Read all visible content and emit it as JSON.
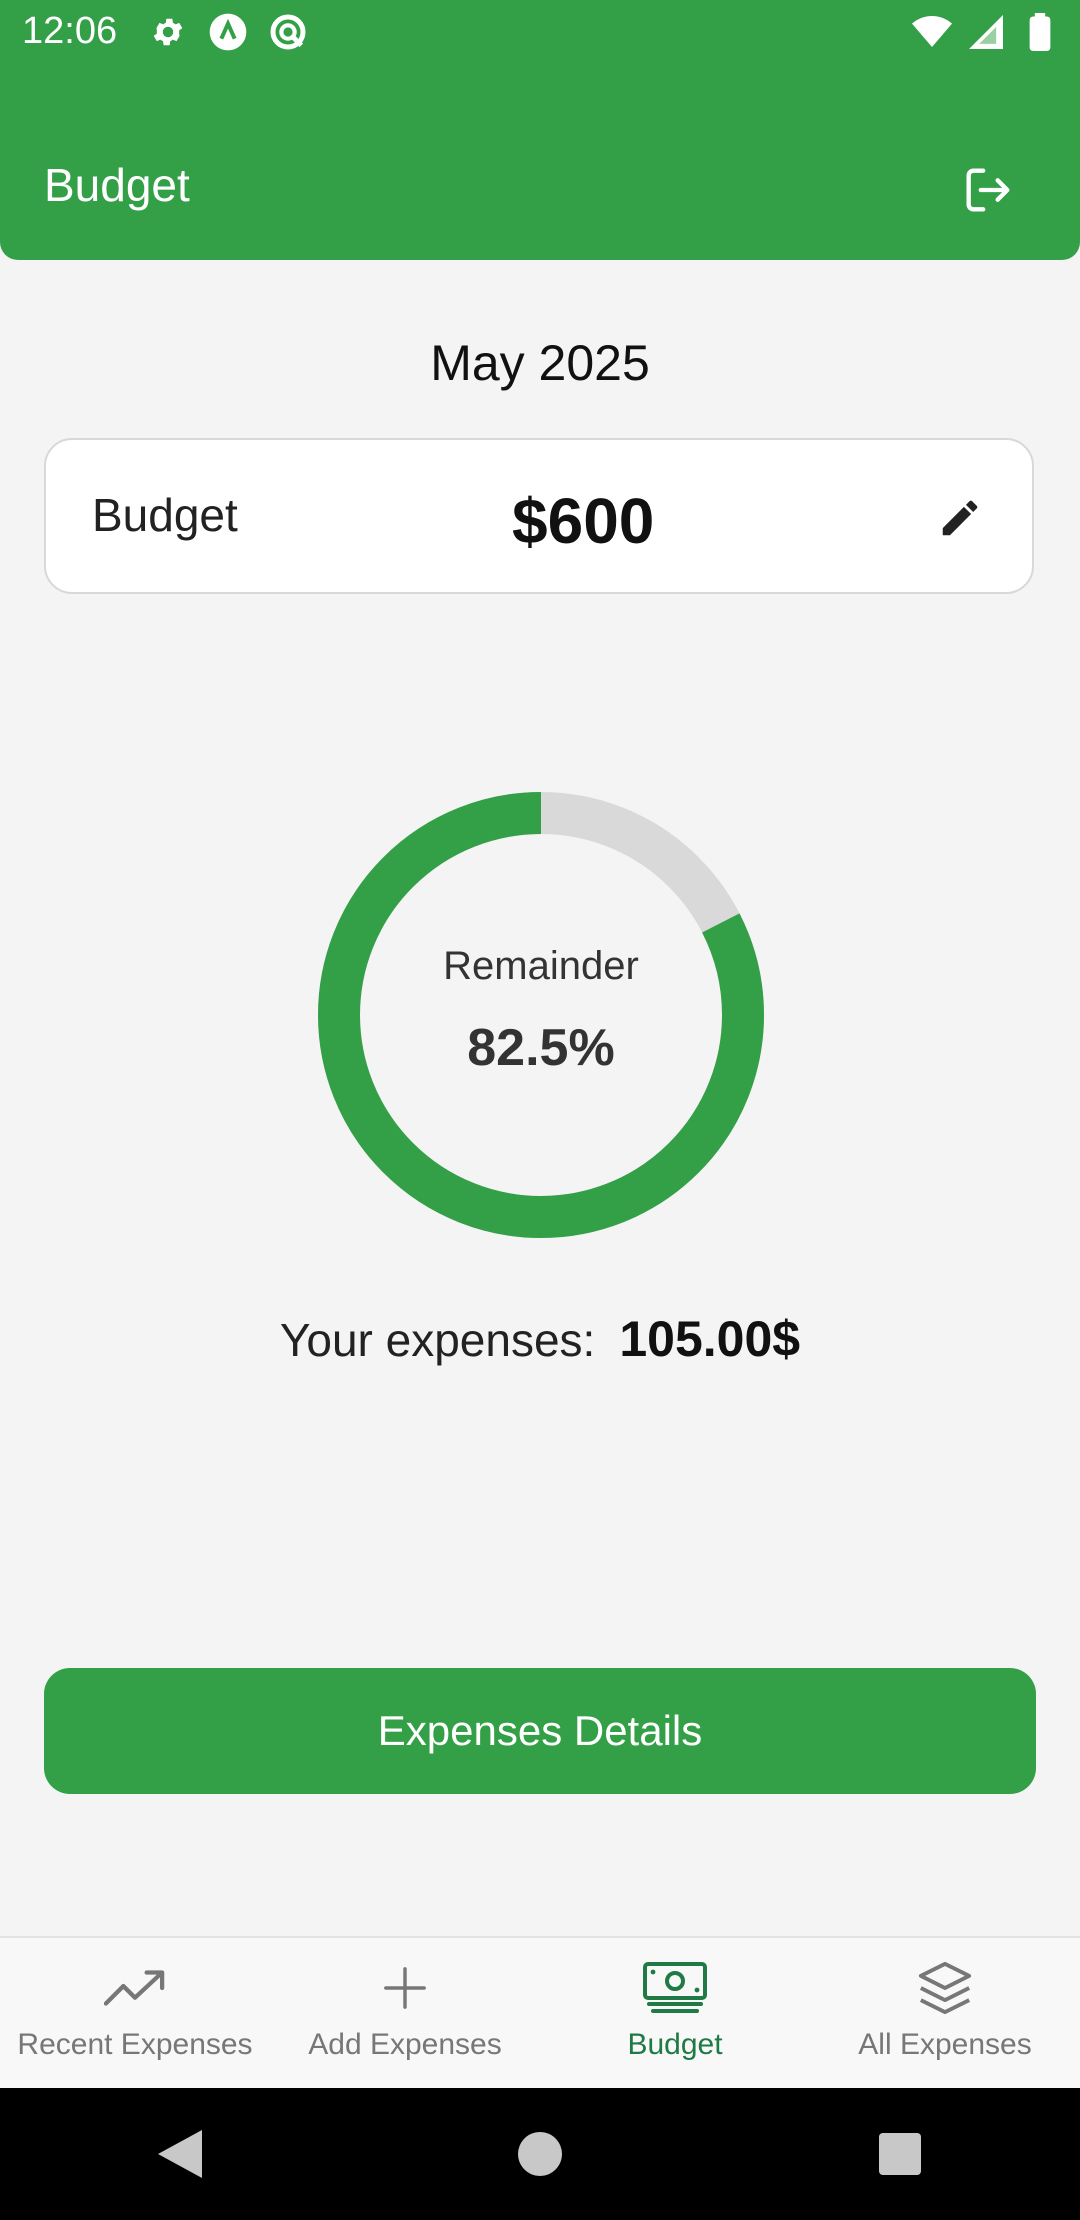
{
  "status_bar": {
    "time": "12:06"
  },
  "app_bar": {
    "title": "Budget"
  },
  "month": "May 2025",
  "budget_card": {
    "label": "Budget",
    "amount": "$600"
  },
  "donut": {
    "label": "Remainder",
    "value_text": "82.5%",
    "remainder_fraction": 0.825,
    "colors": {
      "remainder": "#33a047",
      "spent": "#d9d9d9"
    }
  },
  "expenses": {
    "label": "Your expenses:",
    "value": "105.00$"
  },
  "details_button": "Expenses Details",
  "bottom_nav": {
    "items": [
      {
        "label": "Recent Expenses",
        "icon": "trending-up-icon"
      },
      {
        "label": "Add Expenses",
        "icon": "plus-icon"
      },
      {
        "label": "Budget",
        "icon": "money-icon",
        "active": true
      },
      {
        "label": "All Expenses",
        "icon": "layers-icon"
      }
    ]
  },
  "theme": {
    "primary": "#33a047",
    "active_nav": "#1f7a45"
  }
}
